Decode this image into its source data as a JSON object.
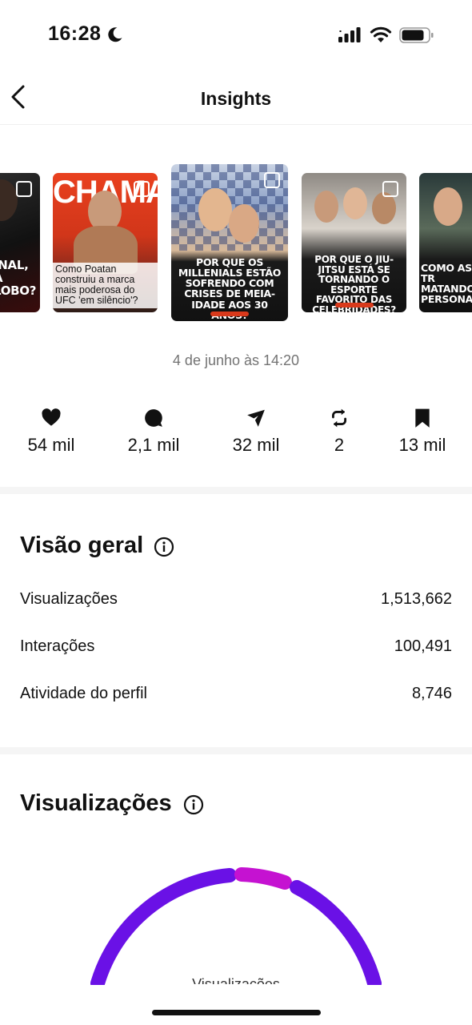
{
  "status_bar": {
    "time": "16:28"
  },
  "nav": {
    "title": "Insights"
  },
  "carousel": {
    "thumb1": {
      "caption": "INAL,\nA\nLOBO?"
    },
    "thumb2": {
      "headline": "CHAMA",
      "caption": "Como Poatan construiu a marca mais poderosa do UFC 'em silêncio'?"
    },
    "thumb3": {
      "caption": "POR QUE OS MILLENIALS ESTÃO SOFRENDO COM CRISES DE MEIA-IDADE AOS 30 ANOS?"
    },
    "thumb4": {
      "caption": "POR QUE O JIU-JITSU ESTÁ SE TORNANDO O ESPORTE FAVORITO DAS CELEBRIDADES?"
    },
    "thumb5": {
      "caption": "COMO AS TR MATANDO PERSONA"
    }
  },
  "post": {
    "date": "4 de junho às 14:20"
  },
  "stats": {
    "likes": "54 mil",
    "comments": "2,1 mil",
    "shares": "32 mil",
    "reposts": "2",
    "saves": "13 mil"
  },
  "overview": {
    "title": "Visão geral",
    "rows": [
      {
        "label": "Visualizações",
        "value": "1,513,662"
      },
      {
        "label": "Interações",
        "value": "100,491"
      },
      {
        "label": "Atividade do perfil",
        "value": "8,746"
      }
    ]
  },
  "views": {
    "title": "Visualizações",
    "gauge_label": "Visualizações",
    "colors": {
      "main": "#6a11e6",
      "accent": "#c512d1"
    }
  }
}
